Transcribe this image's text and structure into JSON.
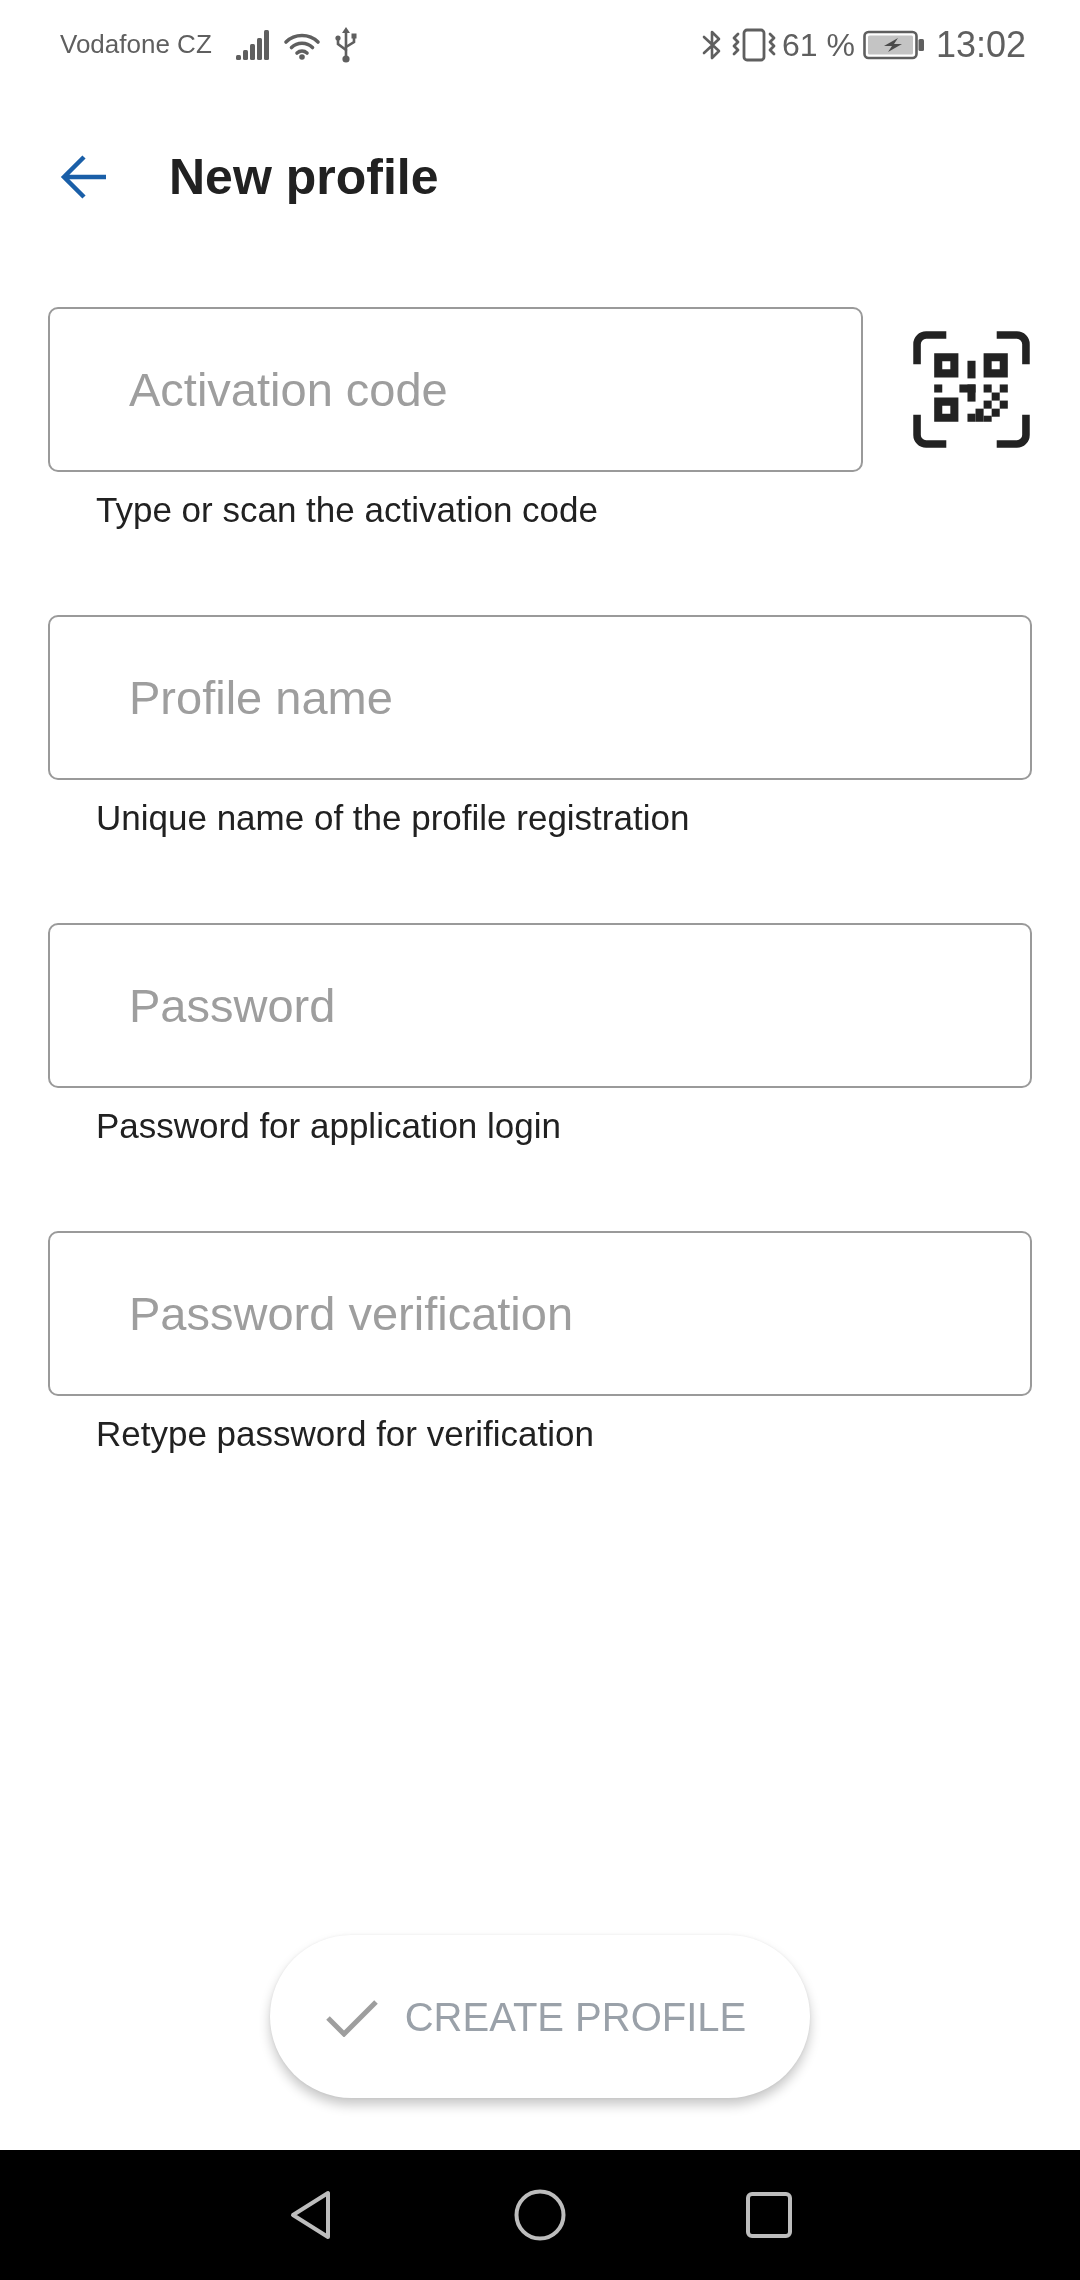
{
  "status_bar": {
    "carrier": "Vodafone CZ",
    "battery_text": "61 %",
    "time": "13:02"
  },
  "app_bar": {
    "title": "New profile"
  },
  "fields": [
    {
      "kind": "scan",
      "placeholder": "Activation code",
      "helper": "Type or scan the activation code"
    },
    {
      "kind": "text",
      "placeholder": "Profile name",
      "helper": "Unique name of the profile registration"
    },
    {
      "kind": "text",
      "placeholder": "Password",
      "helper": "Password for application login"
    },
    {
      "kind": "text",
      "placeholder": "Password verification",
      "helper": "Retype password for verification"
    }
  ],
  "create_button": {
    "label": "CREATE PROFILE",
    "disabled": true
  }
}
